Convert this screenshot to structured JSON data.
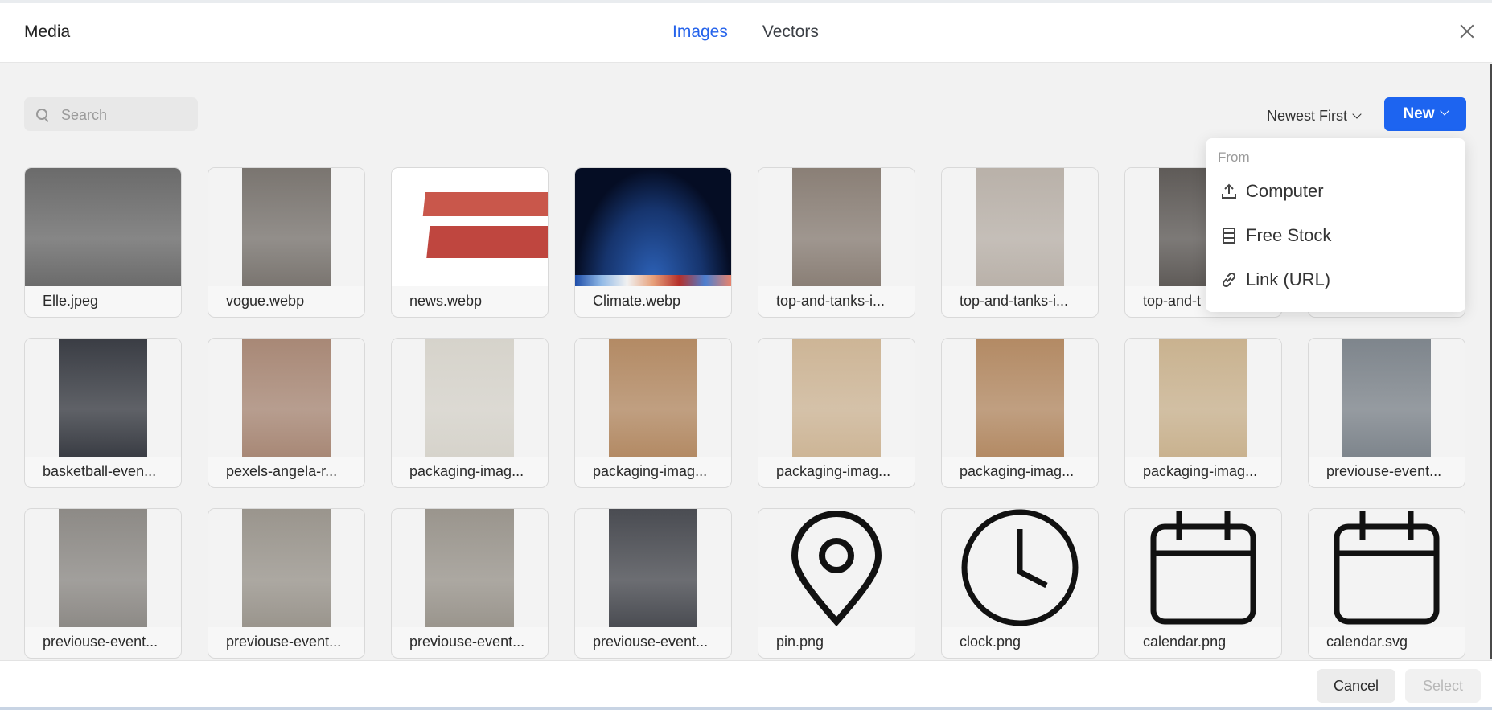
{
  "modal": {
    "title": "Media",
    "tabs": [
      {
        "label": "Images",
        "active": true
      },
      {
        "label": "Vectors",
        "active": false
      }
    ]
  },
  "toolbar": {
    "search_placeholder": "Search",
    "search_value": "",
    "sort_label": "Newest First",
    "new_label": "New"
  },
  "new_menu": {
    "header": "From",
    "items": [
      {
        "label": "Computer",
        "icon": "upload-icon"
      },
      {
        "label": "Free Stock",
        "icon": "stock-icon"
      },
      {
        "label": "Link (URL)",
        "icon": "link-icon"
      }
    ]
  },
  "media": [
    {
      "name": "Elle.jpeg",
      "icon": "photo-portrait",
      "color": "#6b6b6b"
    },
    {
      "name": "vogue.webp",
      "icon": "photo-people",
      "color": "#7a7570"
    },
    {
      "name": "news.webp",
      "icon": "breaking-news",
      "color": "#c0392b"
    },
    {
      "name": "Climate.webp",
      "icon": "earth",
      "color": "#1b3f80"
    },
    {
      "name": "top-and-tanks-i...",
      "icon": "photo-model",
      "color": "#8a7f76"
    },
    {
      "name": "top-and-tanks-i...",
      "icon": "photo-model",
      "color": "#b9b1a9"
    },
    {
      "name": "top-and-t",
      "icon": "photo-model",
      "color": "#5f5b58"
    },
    {
      "name": "",
      "icon": "photo",
      "color": "#a8a8a8"
    },
    {
      "name": "basketball-even...",
      "icon": "photo-sports",
      "color": "#3a3d44"
    },
    {
      "name": "pexels-angela-r...",
      "icon": "photo-people",
      "color": "#a88876"
    },
    {
      "name": "packaging-imag...",
      "icon": "photo-shirt",
      "color": "#d6d3cb"
    },
    {
      "name": "packaging-imag...",
      "icon": "photo-box",
      "color": "#b38a64"
    },
    {
      "name": "packaging-imag...",
      "icon": "photo-box-open",
      "color": "#cdb596"
    },
    {
      "name": "packaging-imag...",
      "icon": "photo-box",
      "color": "#b38a64"
    },
    {
      "name": "packaging-imag...",
      "icon": "photo-box-open",
      "color": "#c9b28f"
    },
    {
      "name": "previouse-event...",
      "icon": "photo-walkers",
      "color": "#7e858c"
    },
    {
      "name": "previouse-event...",
      "icon": "photo-yoga",
      "color": "#8d8a86"
    },
    {
      "name": "previouse-event...",
      "icon": "photo-yoga",
      "color": "#9a958d"
    },
    {
      "name": "previouse-event...",
      "icon": "photo-yoga",
      "color": "#9a958d"
    },
    {
      "name": "previouse-event...",
      "icon": "photo-sports",
      "color": "#4a4c52"
    },
    {
      "name": "pin.png",
      "icon": "pin-icon",
      "color": "#111111"
    },
    {
      "name": "clock.png",
      "icon": "clock-icon",
      "color": "#111111"
    },
    {
      "name": "calendar.png",
      "icon": "calendar-icon",
      "color": "#111111"
    },
    {
      "name": "calendar.svg",
      "icon": "calendar-icon",
      "color": "#111111"
    }
  ],
  "footer": {
    "cancel_label": "Cancel",
    "select_label": "Select"
  },
  "colors": {
    "accent": "#1d64f0",
    "active_tab": "#2563eb"
  }
}
